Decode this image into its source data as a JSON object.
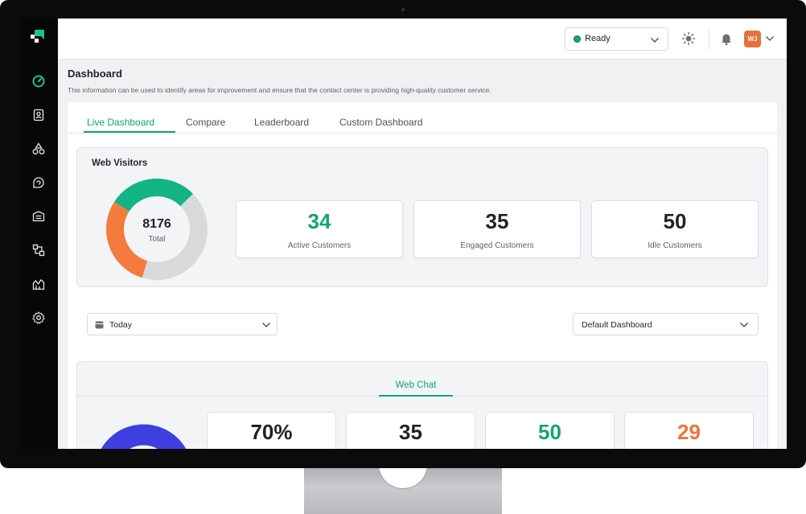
{
  "header": {
    "status": {
      "label": "Ready",
      "color": "#19a866"
    },
    "icons": [
      "sun-icon",
      "bell-icon",
      "chevron-down-icon"
    ],
    "user": {
      "initials": "WJ",
      "color": "#e8703a"
    }
  },
  "sidebar": {
    "items": [
      {
        "name": "dashboard-icon",
        "active": true
      },
      {
        "name": "contacts-icon"
      },
      {
        "name": "shapes-icon"
      },
      {
        "name": "chat-icon"
      },
      {
        "name": "inbox-icon"
      },
      {
        "name": "workflow-icon"
      },
      {
        "name": "analytics-icon"
      },
      {
        "name": "settings-icon"
      }
    ]
  },
  "page": {
    "title": "Dashboard",
    "description": "This information can be used to identify areas for improvement and ensure that the contact center is providing high-quality customer service."
  },
  "tabs": [
    {
      "label": "Live Dashboard",
      "active": true
    },
    {
      "label": "Compare"
    },
    {
      "label": "Leaderboard"
    },
    {
      "label": "Custom Dashboard"
    }
  ],
  "web_visitors": {
    "title": "Web Visitors",
    "total": "8176",
    "total_label": "Total",
    "stats": [
      {
        "value": "34",
        "label": "Active Customers",
        "color": "#12a574"
      },
      {
        "value": "35",
        "label": "Engaged Customers",
        "color": "#1f2329"
      },
      {
        "value": "50",
        "label": "Idle Customers",
        "color": "#1f2329"
      }
    ],
    "segment_colors": {
      "green": "#13b383",
      "orange": "#f47a3e",
      "gray": "#d8d9db"
    }
  },
  "filters": {
    "date": "Today",
    "dashboard": "Default Dashboard"
  },
  "web_chat": {
    "tab_label": "Web Chat",
    "stats": [
      {
        "value": "70%",
        "color": "#1f2329"
      },
      {
        "value": "35",
        "color": "#1f2329"
      },
      {
        "value": "50",
        "color": "#12a574"
      },
      {
        "value": "29",
        "color": "#f0743a"
      }
    ],
    "donut_color": "#3d3fe0"
  },
  "chart_data": {
    "type": "pie",
    "title": "Web Visitors",
    "categories": [
      "Active Customers",
      "Engaged Customers",
      "Idle Customers"
    ],
    "values": [
      34,
      35,
      50
    ],
    "colors": [
      "#13b383",
      "#f47a3e",
      "#d8d9db"
    ]
  }
}
